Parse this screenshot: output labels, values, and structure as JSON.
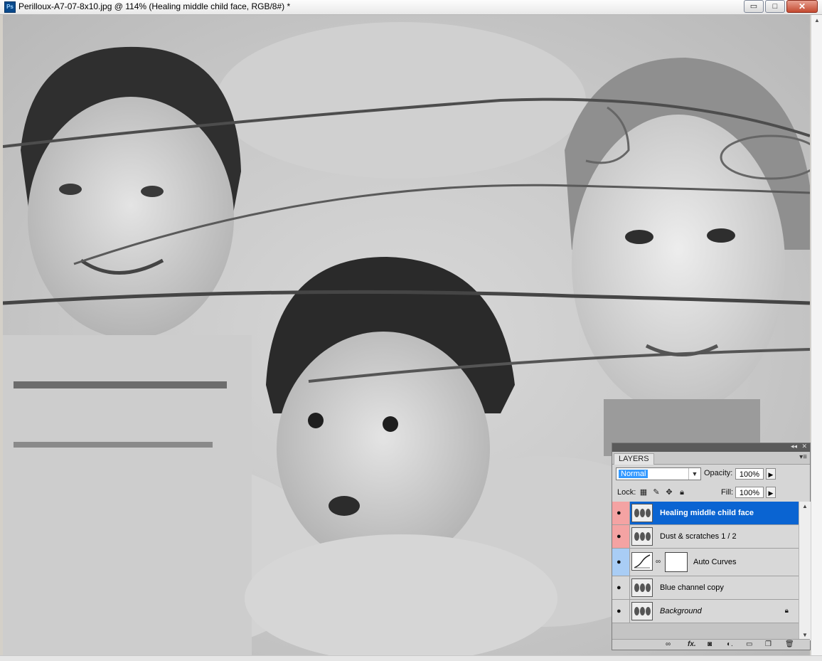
{
  "window": {
    "app_badge": "Ps",
    "title": "Perilloux-A7-07-8x10.jpg @ 114% (Healing middle child face, RGB/8#) *",
    "controls": {
      "minimize": "▭",
      "maximize": "□",
      "close": "✕"
    }
  },
  "layers_panel": {
    "tab_label": "LAYERS",
    "blend_mode": "Normal",
    "opacity_label": "Opacity:",
    "opacity_value": "100%",
    "lock_label": "Lock:",
    "fill_label": "Fill:",
    "fill_value": "100%",
    "layers": [
      {
        "name": "Healing middle child face",
        "selected": true,
        "eye_bg": "red"
      },
      {
        "name": "Dust & scratches 1 /  2",
        "selected": false,
        "eye_bg": "red"
      },
      {
        "name": "Auto Curves",
        "selected": false,
        "eye_bg": "blue"
      },
      {
        "name": "Blue channel copy",
        "selected": false,
        "eye_bg": "none"
      },
      {
        "name": "Background",
        "selected": false,
        "eye_bg": "none"
      }
    ]
  },
  "icons": {
    "eye": "eye-icon",
    "lock": "lock-icon",
    "link": "link-icon",
    "fx": "fx-icon",
    "mask": "mask-icon",
    "adjustment": "adjustment-icon",
    "group": "folder-icon",
    "new_layer": "new-layer-icon",
    "delete": "trash-icon"
  },
  "colors": {
    "selection": "#0a64d2",
    "eye_red": "#f4a3a3",
    "eye_blue": "#a9cdf5"
  }
}
